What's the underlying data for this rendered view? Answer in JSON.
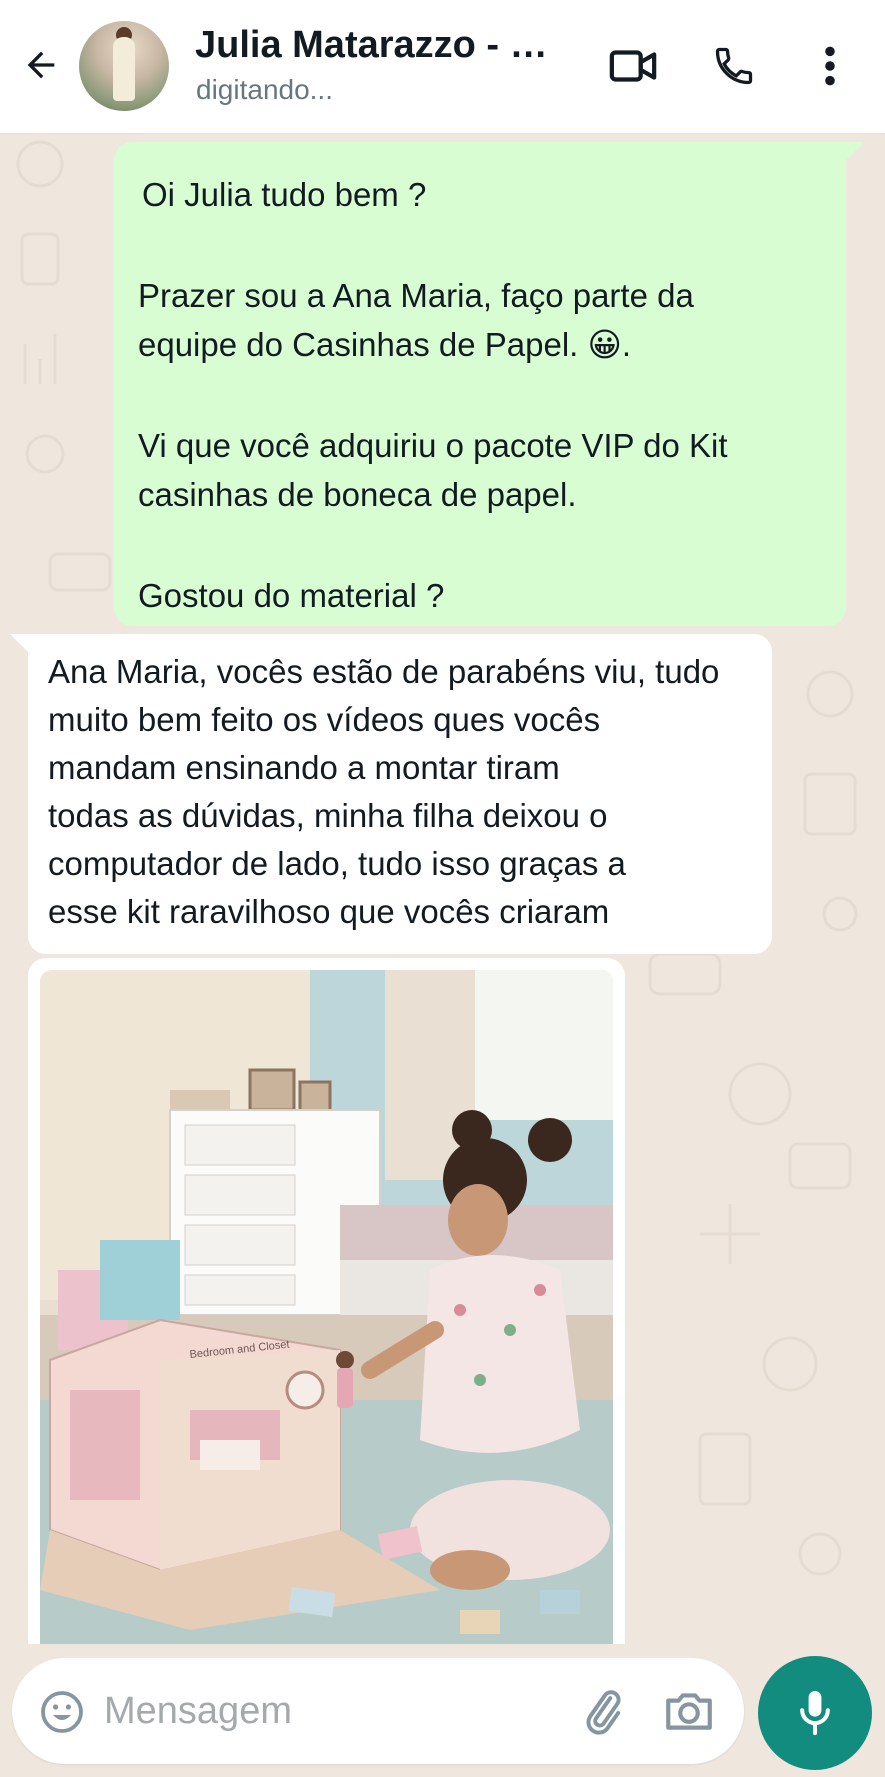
{
  "header": {
    "contact_name": "Julia Matarazzo - …",
    "status": "digitando..."
  },
  "messages": {
    "outgoing": {
      "line1": "Oi Julia tudo bem ?",
      "line2": "Prazer sou a Ana Maria, faço parte da",
      "line3": "equipe do Casinhas de Papel. 😀.",
      "line4": "Vi que você adquiriu o pacote VIP do Kit",
      "line5": "casinhas de boneca de papel.",
      "line6": "Gostou do material ?"
    },
    "incoming": {
      "line1": "Ana Maria, vocês estão de parabéns viu, tudo",
      "line2": "muito bem feito os vídeos ques vocês",
      "line3": "mandam ensinando a montar tiram",
      "line4": "todas as dúvidas, minha filha deixou o",
      "line5": "computador de lado, tudo isso graças a",
      "line6": "esse kit raravilhoso que vocês criaram"
    },
    "image": {
      "book_sign": "Bedroom and Closet"
    }
  },
  "composer": {
    "placeholder": "Mensagem",
    "value": ""
  },
  "colors": {
    "outgoing_bubble": "#d9fdd3",
    "incoming_bubble": "#ffffff",
    "chat_background": "#efe7de",
    "accent": "#128c7e"
  },
  "icons": {
    "back": "arrow-left-icon",
    "video": "video-camera-icon",
    "call": "phone-icon",
    "menu": "more-vertical-icon",
    "emoji": "smiley-icon",
    "attach": "paperclip-icon",
    "camera": "camera-icon",
    "mic": "microphone-icon"
  }
}
